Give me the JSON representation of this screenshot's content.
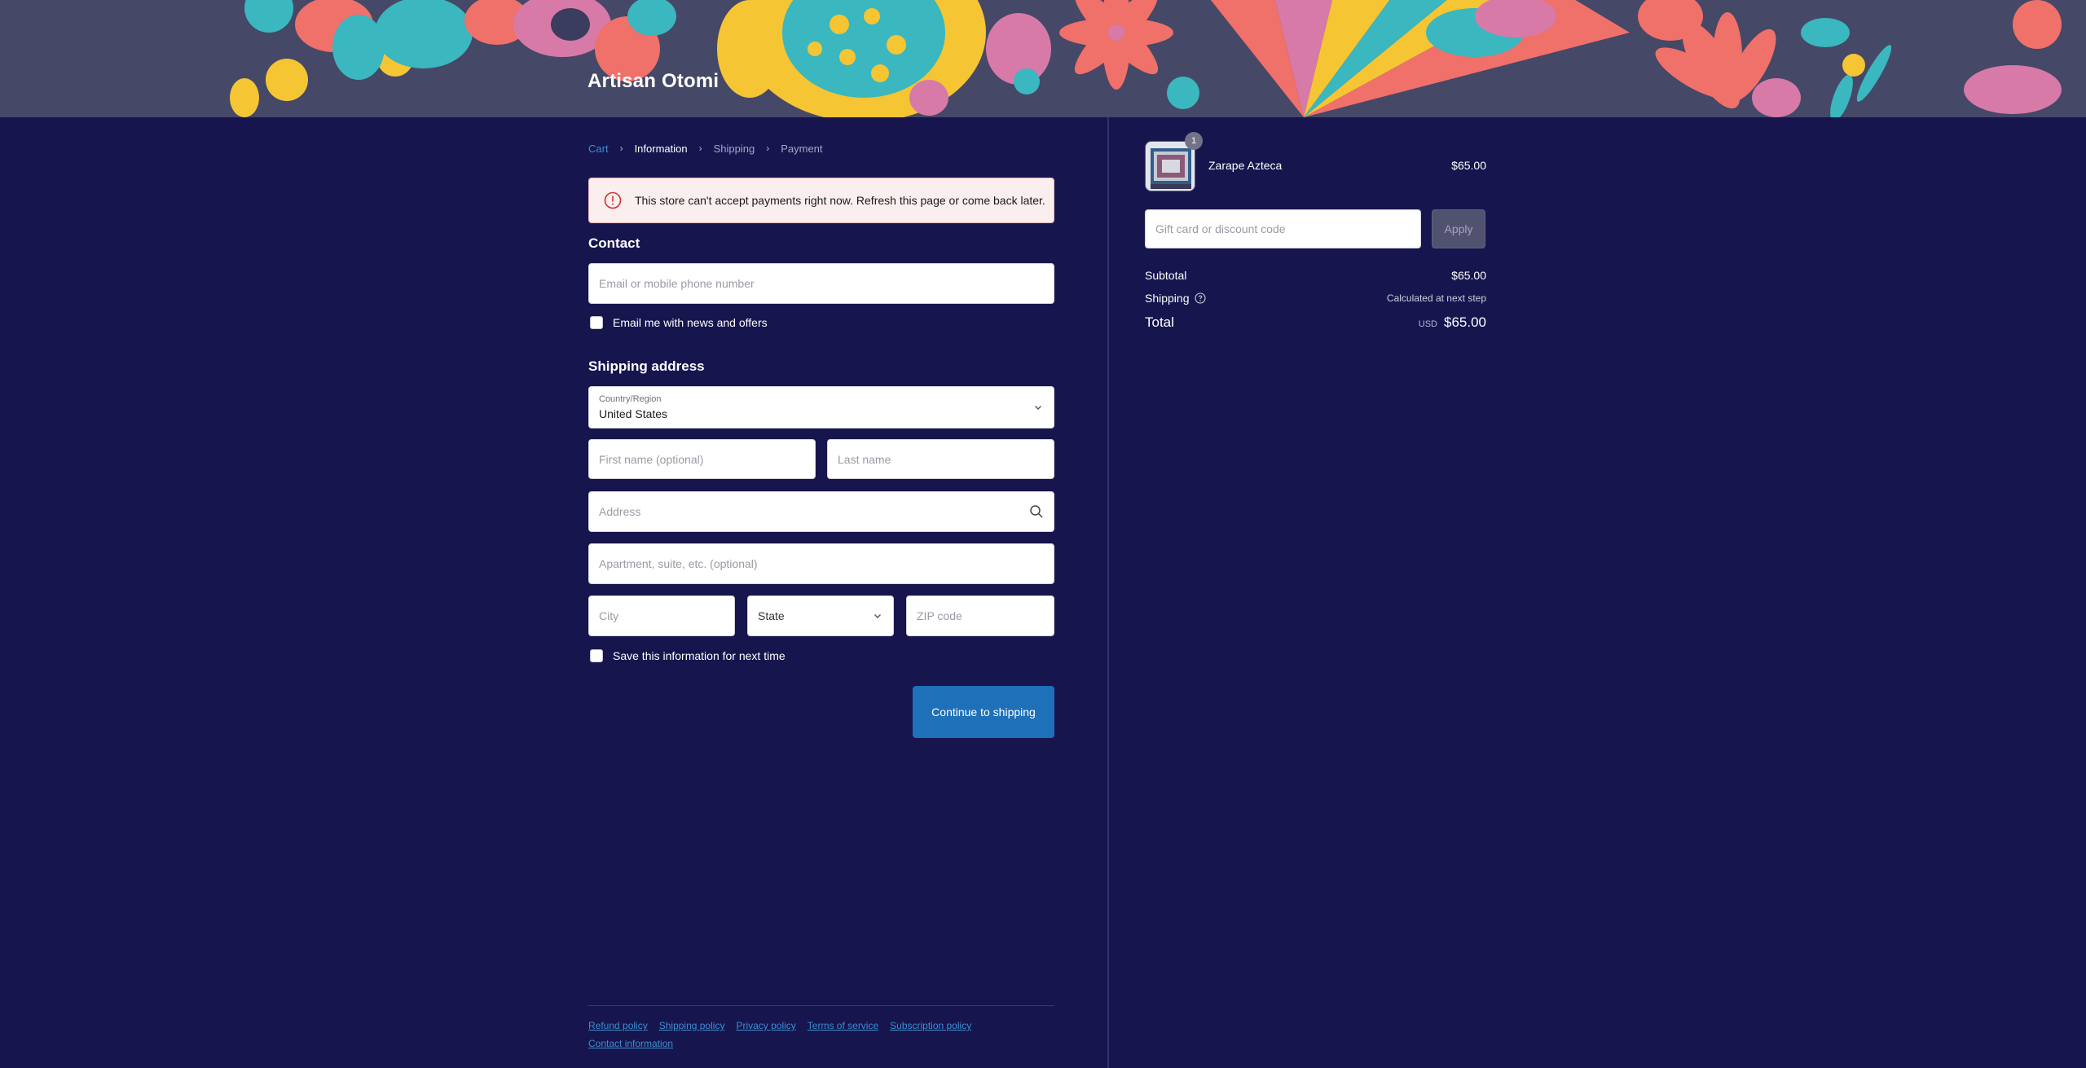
{
  "shop": {
    "name": "Artisan Otomi"
  },
  "breadcrumb": [
    "Cart",
    "Information",
    "Shipping",
    "Payment"
  ],
  "alert": {
    "message": "This store can't accept payments right now. Refresh this page or come back later."
  },
  "contact": {
    "title": "Contact",
    "email_placeholder": "Email or mobile phone number",
    "newsletter_label": "Email me with news and offers"
  },
  "shipping": {
    "title": "Shipping address",
    "country_label": "Country/Region",
    "country_value": "United States",
    "first_name_placeholder": "First name (optional)",
    "last_name_placeholder": "Last name",
    "address_placeholder": "Address",
    "apartment_placeholder": "Apartment, suite, etc. (optional)",
    "city_placeholder": "City",
    "state_value": "State",
    "zip_placeholder": "ZIP code",
    "save_label": "Save this information for next time",
    "continue_label": "Continue to shipping"
  },
  "footer": {
    "links": [
      "Refund policy",
      "Shipping policy",
      "Privacy policy",
      "Terms of service",
      "Subscription policy"
    ],
    "contact": "Contact information"
  },
  "summary": {
    "product": {
      "name": "Zarape Azteca",
      "price": "$65.00",
      "quantity": "1"
    },
    "discount_placeholder": "Gift card or discount code",
    "apply_label": "Apply",
    "subtotal_label": "Subtotal",
    "subtotal_value": "$65.00",
    "shipping_label": "Shipping",
    "shipping_value": "Calculated at next step",
    "total_label": "Total",
    "currency": "USD",
    "total_value": "$65.00"
  },
  "colors": {
    "background": "#17154e",
    "accent": "#1e70b8",
    "link": "#3c8ed1",
    "alert_bg": "#fbeeee",
    "alert_icon": "#d0312d"
  }
}
